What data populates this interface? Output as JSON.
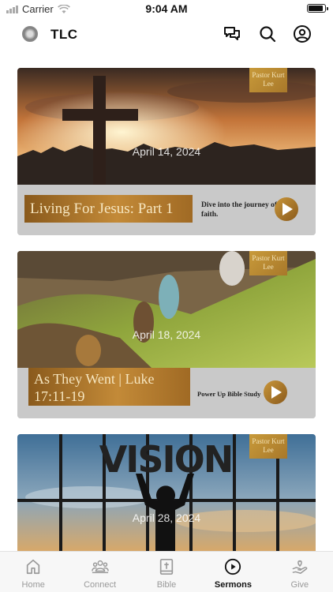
{
  "status_bar": {
    "carrier": "Carrier",
    "time": "9:04 AM",
    "battery_level": 0.9
  },
  "header": {
    "title": "TLC",
    "icons": [
      "chat-icon",
      "search-icon",
      "profile-icon"
    ]
  },
  "sermons": [
    {
      "pastor": "Pastor Kurt Lee",
      "date": "April 14, 2024",
      "title": "Living For Jesus: Part 1",
      "tagline": "Dive into the journey of faith.",
      "image": "cross-sunset"
    },
    {
      "pastor": "Pastor Kurt Lee",
      "date": "April 18, 2024",
      "title": "As They Went | Luke 17:11-19",
      "tagline": "Power Up Bible Study",
      "image": "hill-climbers"
    },
    {
      "pastor": "Pastor Kurt Lee",
      "date": "April 28, 2024",
      "title": "",
      "tagline": "",
      "image_text": "VISION",
      "image": "vision-sky"
    }
  ],
  "tabs": [
    {
      "label": "Home",
      "icon": "home-icon",
      "active": false
    },
    {
      "label": "Connect",
      "icon": "people-icon",
      "active": false
    },
    {
      "label": "Bible",
      "icon": "bible-icon",
      "active": false
    },
    {
      "label": "Sermons",
      "icon": "play-circle-icon",
      "active": true
    },
    {
      "label": "Give",
      "icon": "give-hand-icon",
      "active": false
    }
  ],
  "colors": {
    "accent_gold": "#b07a2c",
    "footer_gray": "#c9c9c9",
    "tab_inactive": "#999999"
  }
}
